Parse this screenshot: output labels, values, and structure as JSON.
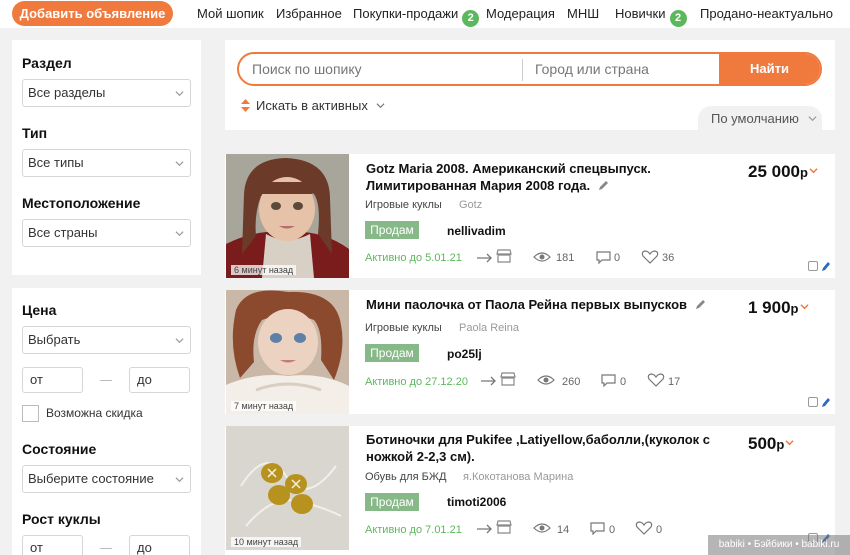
{
  "topnav": {
    "add_button": "Добавить объявление",
    "items": [
      {
        "label": "Мой шопик"
      },
      {
        "label": "Избранное"
      },
      {
        "label": "Покупки-продажи",
        "badge": "2"
      },
      {
        "label": "Модерация"
      },
      {
        "label": "МНШ"
      },
      {
        "label": "Новички",
        "badge": "2"
      },
      {
        "label": "Продано-неактуально"
      }
    ]
  },
  "sidebar": {
    "section_label": "Раздел",
    "section_value": "Все разделы",
    "type_label": "Тип",
    "type_value": "Все типы",
    "location_label": "Местоположение",
    "location_value": "Все страны",
    "price_label": "Цена",
    "price_value": "Выбрать",
    "from_placeholder": "от",
    "to_placeholder": "до",
    "discount_label": "Возможна скидка",
    "condition_label": "Состояние",
    "condition_value": "Выберите состояние",
    "height_label": "Рост куклы",
    "height_from": "от",
    "height_to": "до"
  },
  "search": {
    "query_placeholder": "Поиск по шопику",
    "city_placeholder": "Город или страна",
    "button": "Найти",
    "filter": "Искать в активных",
    "sort": "По умолчанию"
  },
  "listings": [
    {
      "title_line1": "Gotz Maria 2008. Американский спецвыпуск.",
      "title_line2": "Лимитированная Мария 2008 года.",
      "price": "25 000",
      "currency": "р",
      "category": "Игровые куклы",
      "brand": "Gotz",
      "deal": "Продам",
      "seller": "nellivadim",
      "active_until": "Активно до 5.01.21",
      "views": "181",
      "comments": "0",
      "likes": "36",
      "time": "6 минут назад"
    },
    {
      "title_line1": "Мини паолочка от Паола Рейна первых выпусков",
      "title_line2": "",
      "price": "1 900",
      "currency": "р",
      "category": "Игровые куклы",
      "brand": "Paola Reina",
      "deal": "Продам",
      "seller": "po25lj",
      "active_until": "Активно до 27.12.20",
      "views": "260",
      "comments": "0",
      "likes": "17",
      "time": "7 минут назад"
    },
    {
      "title_line1": "Ботиночки для Pukifee ,Latiyellow,баболли,(куколок с",
      "title_line2": "ножкой 2-2,3 см).",
      "price": "500",
      "currency": "р",
      "category": "Обувь для БЖД",
      "brand": "я.Кокотанова Марина",
      "deal": "Продам",
      "seller": "timoti2006",
      "active_until": "Активно до 7.01.21",
      "views": "14",
      "comments": "0",
      "likes": "0",
      "time": "10 минут назад"
    }
  ],
  "watermark": "babiki • Бэйбики • babiki.ru",
  "colors": {
    "accent": "#f07a3e",
    "badge": "#5cb85c",
    "deal": "#86b987"
  }
}
